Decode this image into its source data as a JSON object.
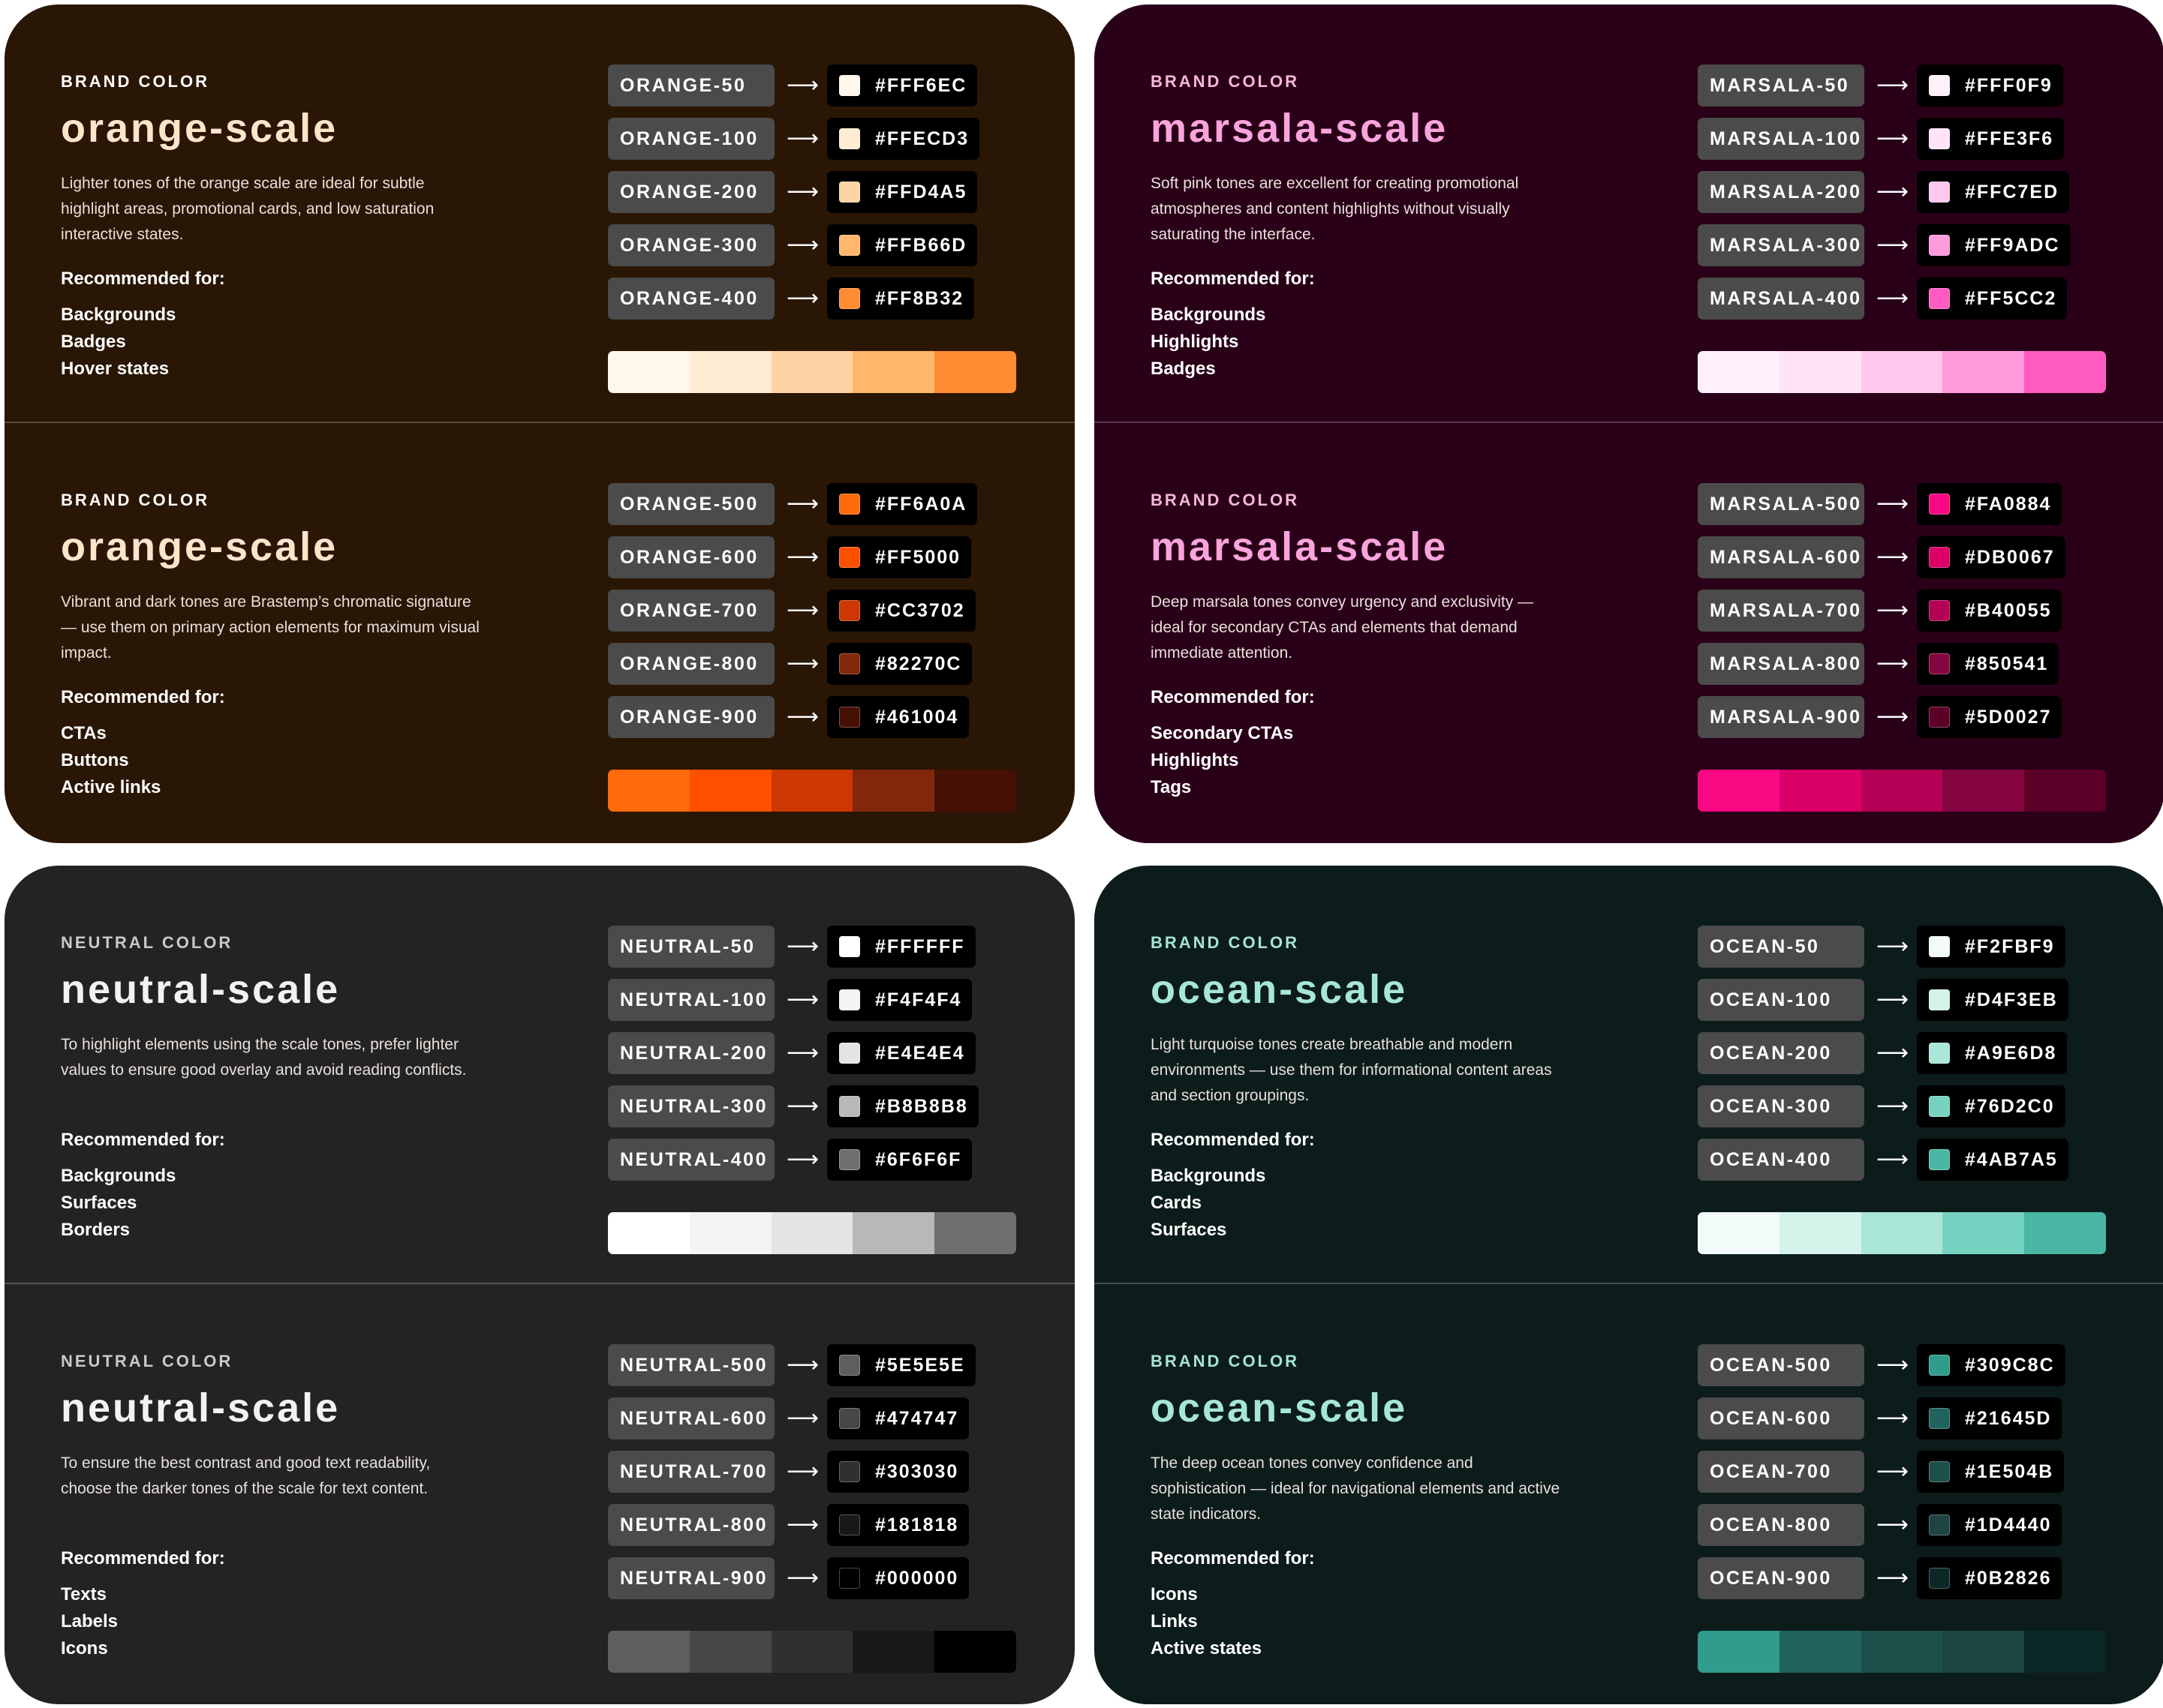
{
  "cards": [
    {
      "theme": {
        "bg": "#2a1604",
        "eyebrow": "#ffffff",
        "title": "#fde4cb"
      },
      "sections": [
        {
          "eyebrow": "BRAND COLOR",
          "title": "orange-scale",
          "description": "Lighter tones of the orange scale are ideal for subtle highlight areas, promotional cards, and low saturation interactive states.",
          "recommended_label": "Recommended for:",
          "recommended": [
            "Backgrounds",
            "Badges",
            "Hover states"
          ],
          "swatches": [
            {
              "token": "ORANGE-50",
              "hex": "#FFF6EC",
              "color": "#FFF6EC"
            },
            {
              "token": "ORANGE-100",
              "hex": "#FFECD3",
              "color": "#FFECD3"
            },
            {
              "token": "ORANGE-200",
              "hex": "#FFD4A5",
              "color": "#FFD4A5"
            },
            {
              "token": "ORANGE-300",
              "hex": "#FFB66D",
              "color": "#FFB66D"
            },
            {
              "token": "ORANGE-400",
              "hex": "#FF8B32",
              "color": "#FF8B32"
            }
          ]
        },
        {
          "eyebrow": "BRAND COLOR",
          "title": "orange-scale",
          "description": "Vibrant and dark tones are Brastemp’s chromatic signature — use them on primary action elements for maximum visual impact.",
          "recommended_label": "Recommended for:",
          "recommended": [
            "CTAs",
            "Buttons",
            "Active links"
          ],
          "swatches": [
            {
              "token": "ORANGE-500",
              "hex": "#FF6A0A",
              "color": "#FF6A0A"
            },
            {
              "token": "ORANGE-600",
              "hex": "#FF5000",
              "color": "#FF5000"
            },
            {
              "token": "ORANGE-700",
              "hex": "#CC3702",
              "color": "#CC3702"
            },
            {
              "token": "ORANGE-800",
              "hex": "#82270C",
              "color": "#82270C"
            },
            {
              "token": "ORANGE-900",
              "hex": "#461004",
              "color": "#461004"
            }
          ]
        }
      ]
    },
    {
      "theme": {
        "bg": "#2a0018",
        "eyebrow": "#f7b6dc",
        "title": "#f9a4dc"
      },
      "sections": [
        {
          "eyebrow": "BRAND COLOR",
          "title": "marsala-scale",
          "description": "Soft pink tones are excellent for creating promotional atmospheres and content highlights without visually saturating the interface.",
          "recommended_label": "Recommended for:",
          "recommended": [
            "Backgrounds",
            "Highlights",
            "Badges"
          ],
          "swatches": [
            {
              "token": "MARSALA-50",
              "hex": "#FFF0F9",
              "color": "#FFF0F9"
            },
            {
              "token": "MARSALA-100",
              "hex": "#FFE3F6",
              "color": "#FFE3F6"
            },
            {
              "token": "MARSALA-200",
              "hex": "#FFC7ED",
              "color": "#FFC7ED"
            },
            {
              "token": "MARSALA-300",
              "hex": "#FF9ADC",
              "color": "#FF9ADC"
            },
            {
              "token": "MARSALA-400",
              "hex": "#FF5CC2",
              "color": "#FF5CC2"
            }
          ]
        },
        {
          "eyebrow": "BRAND COLOR",
          "title": "marsala-scale",
          "description": "Deep marsala tones convey urgency and exclusivity — ideal for secondary CTAs and elements that demand immediate attention.",
          "recommended_label": "Recommended for:",
          "recommended": [
            "Secondary CTAs",
            "Highlights",
            "Tags"
          ],
          "swatches": [
            {
              "token": "MARSALA-500",
              "hex": "#FA0884",
              "color": "#FA0884"
            },
            {
              "token": "MARSALA-600",
              "hex": "#DB0067",
              "color": "#DB0067"
            },
            {
              "token": "MARSALA-700",
              "hex": "#B40055",
              "color": "#B40055"
            },
            {
              "token": "MARSALA-800",
              "hex": "#850541",
              "color": "#850541"
            },
            {
              "token": "MARSALA-900",
              "hex": "#5D0027",
              "color": "#5D0027"
            }
          ]
        }
      ]
    },
    {
      "theme": {
        "bg": "#232323",
        "eyebrow": "#c9c9c9",
        "title": "#f2f2f2"
      },
      "sections": [
        {
          "eyebrow": "NEUTRAL COLOR",
          "title": "neutral-scale",
          "description": "To highlight elements using the scale tones, prefer lighter values to ensure good overlay and avoid reading conflicts.",
          "recommended_label": "Recommended for:",
          "recommended": [
            "Backgrounds",
            "Surfaces",
            "Borders"
          ],
          "swatches": [
            {
              "token": "NEUTRAL-50",
              "hex": "#FFFFFF",
              "color": "#FFFFFF"
            },
            {
              "token": "NEUTRAL-100",
              "hex": "#F4F4F4",
              "color": "#F4F4F4"
            },
            {
              "token": "NEUTRAL-200",
              "hex": "#E4E4E4",
              "color": "#E4E4E4"
            },
            {
              "token": "NEUTRAL-300",
              "hex": "#B8B8B8",
              "color": "#B8B8B8"
            },
            {
              "token": "NEUTRAL-400",
              "hex": "#6F6F6F",
              "color": "#6F6F6F"
            }
          ]
        },
        {
          "eyebrow": "NEUTRAL COLOR",
          "title": "neutral-scale",
          "description": "To ensure the best contrast and good text readability, choose the darker tones of the scale for text content.",
          "recommended_label": "Recommended for:",
          "recommended": [
            "Texts",
            "Labels",
            "Icons"
          ],
          "swatches": [
            {
              "token": "NEUTRAL-500",
              "hex": "#5E5E5E",
              "color": "#5E5E5E"
            },
            {
              "token": "NEUTRAL-600",
              "hex": "#474747",
              "color": "#474747"
            },
            {
              "token": "NEUTRAL-700",
              "hex": "#303030",
              "color": "#303030"
            },
            {
              "token": "NEUTRAL-800",
              "hex": "#181818",
              "color": "#181818"
            },
            {
              "token": "NEUTRAL-900",
              "hex": "#000000",
              "color": "#000000"
            }
          ]
        }
      ]
    },
    {
      "theme": {
        "bg": "#0b1c1b",
        "eyebrow": "#a6e3d6",
        "title": "#a6e6d8"
      },
      "sections": [
        {
          "eyebrow": "BRAND COLOR",
          "title": "ocean-scale",
          "description": "Light turquoise tones create breathable and modern environments — use them for informational content areas and section groupings.",
          "recommended_label": "Recommended for:",
          "recommended": [
            "Backgrounds",
            "Cards",
            "Surfaces"
          ],
          "swatches": [
            {
              "token": "OCEAN-50",
              "hex": "#F2FBF9",
              "color": "#F2FBF9"
            },
            {
              "token": "OCEAN-100",
              "hex": "#D4F3EB",
              "color": "#D4F3EB"
            },
            {
              "token": "OCEAN-200",
              "hex": "#A9E6D8",
              "color": "#A9E6D8"
            },
            {
              "token": "OCEAN-300",
              "hex": "#76D2C0",
              "color": "#76D2C0"
            },
            {
              "token": "OCEAN-400",
              "hex": "#4AB7A5",
              "color": "#4AB7A5"
            }
          ]
        },
        {
          "eyebrow": "BRAND COLOR",
          "title": "ocean-scale",
          "description": "The deep ocean tones convey confidence and sophistication — ideal for navigational elements and active state indicators.",
          "recommended_label": "Recommended for:",
          "recommended": [
            "Icons",
            "Links",
            "Active states"
          ],
          "swatches": [
            {
              "token": "OCEAN-500",
              "hex": "#309C8C",
              "color": "#309C8C"
            },
            {
              "token": "OCEAN-600",
              "hex": "#21645D",
              "color": "#21645D"
            },
            {
              "token": "OCEAN-700",
              "hex": "#1E504B",
              "color": "#1E504B"
            },
            {
              "token": "OCEAN-800",
              "hex": "#1D4440",
              "color": "#1D4440"
            },
            {
              "token": "OCEAN-900",
              "hex": "#0B2826",
              "color": "#0B2826"
            }
          ]
        }
      ]
    }
  ]
}
